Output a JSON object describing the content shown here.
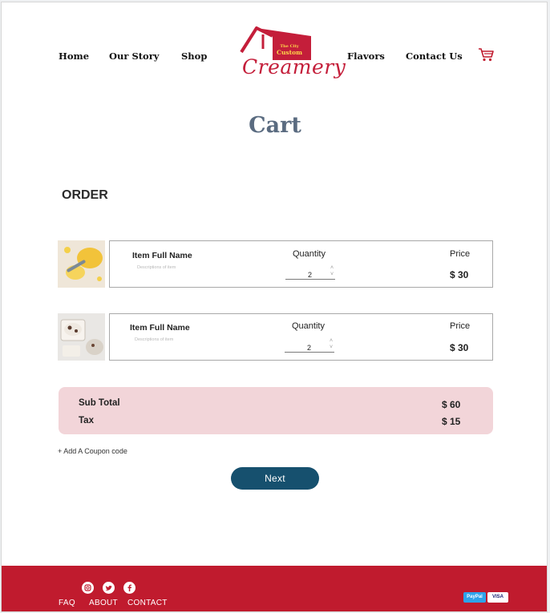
{
  "header": {
    "nav_left": [
      "Home",
      "Our Story",
      "Shop"
    ],
    "nav_right": [
      "Flavors",
      "Contact Us"
    ],
    "logo": {
      "small": "The City",
      "custom": "Custom",
      "word": "Creamery"
    },
    "cart_icon": "shopping-cart-icon"
  },
  "page_title": "Cart",
  "section_title": "ORDER",
  "items": [
    {
      "name": "Item Full Name",
      "description": "Descriptions of item",
      "quantity_label": "Quantity",
      "quantity": "2",
      "price_label": "Price",
      "price": "$ 30"
    },
    {
      "name": "Item Full Name",
      "description": "Descriptions of item",
      "quantity_label": "Quantity",
      "quantity": "2",
      "price_label": "Price",
      "price": "$ 30"
    }
  ],
  "summary": {
    "subtotal_label": "Sub Total",
    "subtotal_value": "$ 60",
    "tax_label": "Tax",
    "tax_value": "$ 15"
  },
  "coupon_label": "+ Add A Coupon code",
  "next_label": "Next",
  "footer": {
    "social_icons": [
      "instagram-icon",
      "twitter-icon",
      "facebook-icon"
    ],
    "links": [
      "FAQ",
      "ABOUT",
      "CONTACT"
    ],
    "payment": [
      "PayPal",
      "VISA"
    ]
  },
  "colors": {
    "brand_red": "#c01b2e",
    "title_slate": "#5a6b80",
    "summary_pink": "#f2d5d9",
    "button_blue": "#16506e"
  }
}
